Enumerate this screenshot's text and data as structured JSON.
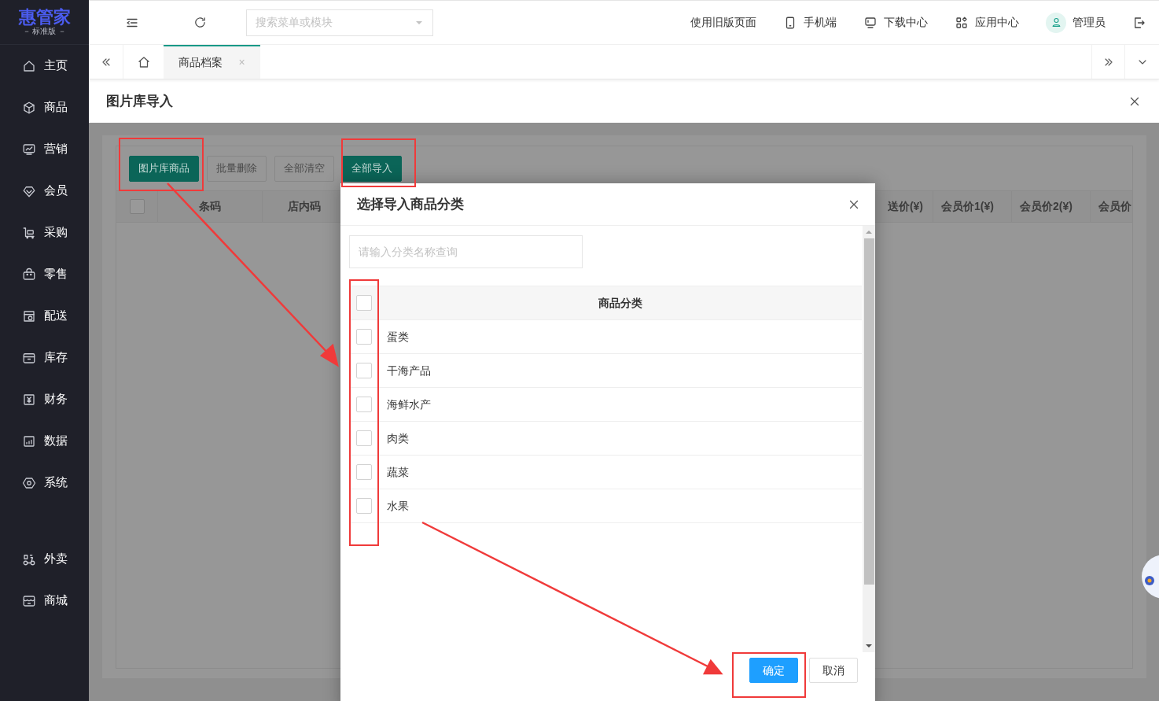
{
  "sidebar": {
    "logo": {
      "title": "惠管家",
      "subtitle": "－ 标准版 －"
    },
    "items": [
      {
        "label": "主页"
      },
      {
        "label": "商品"
      },
      {
        "label": "营销"
      },
      {
        "label": "会员"
      },
      {
        "label": "采购"
      },
      {
        "label": "零售"
      },
      {
        "label": "配送"
      },
      {
        "label": "库存"
      },
      {
        "label": "财务"
      },
      {
        "label": "数据"
      },
      {
        "label": "系统"
      }
    ],
    "extra_items": [
      {
        "label": "外卖"
      },
      {
        "label": "商城"
      }
    ]
  },
  "topbar": {
    "search": {
      "placeholder": "搜索菜单或模块"
    },
    "links": [
      {
        "label": "使用旧版页面"
      },
      {
        "label": "手机端"
      },
      {
        "label": "下载中心"
      },
      {
        "label": "应用中心"
      },
      {
        "label": "管理员"
      }
    ]
  },
  "tabs": [
    {
      "label": "商品档案",
      "close": "×",
      "selected": true
    }
  ],
  "page": {
    "title": "图片库导入",
    "toolbar": [
      {
        "label": "图片库商品",
        "kind": "primary"
      },
      {
        "label": "批量删除",
        "kind": "default"
      },
      {
        "label": "全部清空",
        "kind": "default"
      },
      {
        "label": "全部导入",
        "kind": "primary"
      }
    ],
    "table": {
      "columns_left": [
        "条码",
        "店内码"
      ],
      "columns_right": [
        "送价(¥)",
        "会员价1(¥)",
        "会员价2(¥)",
        "会员价"
      ],
      "header_checked": false
    }
  },
  "dialog": {
    "title": "选择导入商品分类",
    "search": {
      "placeholder": "请输入分类名称查询"
    },
    "column": "商品分类",
    "header_checked": false,
    "rows": [
      {
        "label": "蛋类",
        "checked": false
      },
      {
        "label": "干海产品",
        "checked": false
      },
      {
        "label": "海鲜水产",
        "checked": false
      },
      {
        "label": "肉类",
        "checked": false
      },
      {
        "label": "蔬菜",
        "checked": false
      },
      {
        "label": "水果",
        "checked": false
      }
    ],
    "buttons": [
      {
        "label": "确定",
        "kind": "primary"
      },
      {
        "label": "取消",
        "kind": "default"
      }
    ]
  }
}
